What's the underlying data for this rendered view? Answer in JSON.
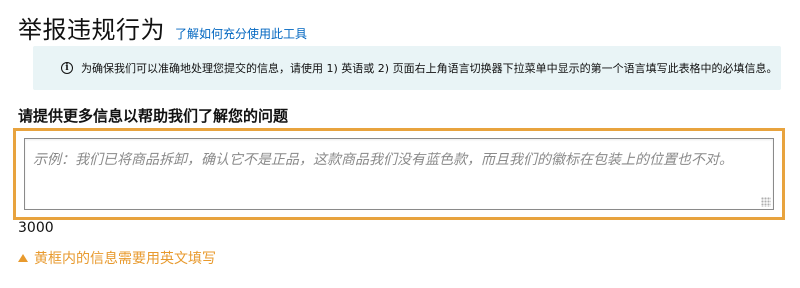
{
  "header": {
    "title": "举报违规行为",
    "help_link": "了解如何充分使用此工具"
  },
  "info_banner": {
    "icon": "info-icon",
    "text": "为确保我们可以准确地处理您提交的信息，请使用 1) 英语或 2) 页面右上角语言切换器下拉菜单中显示的第一个语言填写此表格中的必填信息。"
  },
  "form": {
    "section_label": "请提供更多信息以帮助我们了解您的问题",
    "textarea": {
      "value": "",
      "placeholder": "示例：我们已将商品拆卸，确认它不是正品，这款商品我们没有蓝色款，而且我们的徽标在包装上的位置也不对。"
    },
    "char_counter": "3000"
  },
  "note": {
    "icon": "warning-triangle-icon",
    "text": "黄框内的信息需要用英文填写"
  },
  "colors": {
    "link": "#0066c0",
    "banner_bg": "#e9f4f6",
    "highlight": "#e8a33e",
    "note_text": "#e89a2e"
  }
}
